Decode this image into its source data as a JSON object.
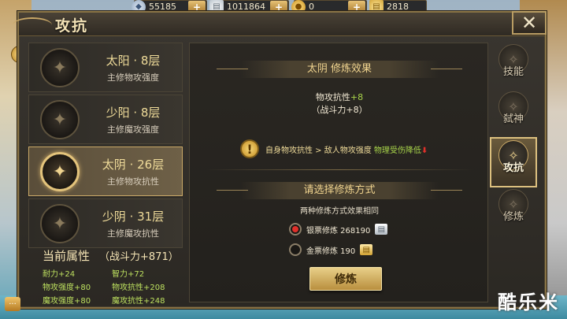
{
  "currency": [
    {
      "icon": "diamond-icon",
      "glyph": "◆",
      "value": "55185"
    },
    {
      "icon": "silver-note-icon",
      "glyph": "▤",
      "value": "1011864"
    },
    {
      "icon": "coin-icon",
      "glyph": "●",
      "value": "0"
    },
    {
      "icon": "gold-note-icon",
      "glyph": "▤",
      "value": "2818"
    }
  ],
  "window": {
    "title": "攻抗",
    "close": "✕"
  },
  "list": [
    {
      "name": "太阳 · 8层",
      "desc": "主修物攻强度",
      "glyph": "✦",
      "active": false
    },
    {
      "name": "少阳 · 8层",
      "desc": "主修魔攻强度",
      "glyph": "✦",
      "active": false
    },
    {
      "name": "太阴 · 26层",
      "desc": "主修物攻抗性",
      "glyph": "✦",
      "active": true
    },
    {
      "name": "少阴 · 31层",
      "desc": "主修魔攻抗性",
      "glyph": "✦",
      "active": false
    }
  ],
  "attributes": {
    "title": "当前属性",
    "power": "（战斗力+871）",
    "items": [
      "耐力+24",
      "智力+72",
      "物攻强度+80",
      "物攻抗性+208",
      "魔攻强度+80",
      "魔攻抗性+248"
    ]
  },
  "effect": {
    "header": "太阴 修炼效果",
    "stat_label": "物攻抗性",
    "stat_value": "+8",
    "power_line": "（战斗力+8）",
    "warn_text": "自身物攻抗性 > 敌人物攻强度 ",
    "warn_effect": "物理受伤降低",
    "warn_arrow": "⬇"
  },
  "method": {
    "header": "请选择修炼方式",
    "sub": "两种修炼方式效果相同",
    "options": [
      {
        "label": "银票修炼 268190",
        "selected": true,
        "icon": "silver-note-icon"
      },
      {
        "label": "金票修炼 190",
        "selected": false,
        "icon": "gold-note-icon"
      }
    ],
    "button": "修炼"
  },
  "tabs": [
    {
      "label": "技能",
      "glyph": "✧",
      "active": false
    },
    {
      "label": "弑神",
      "glyph": "✧",
      "active": false
    },
    {
      "label": "攻抗",
      "glyph": "✧",
      "active": true
    },
    {
      "label": "修炼",
      "glyph": "✧",
      "active": false
    }
  ],
  "watermark": "酷乐米",
  "colors": {
    "accent_gold": "#c9a867",
    "green_text": "#a8d44a",
    "red_arrow": "#e0302a"
  }
}
